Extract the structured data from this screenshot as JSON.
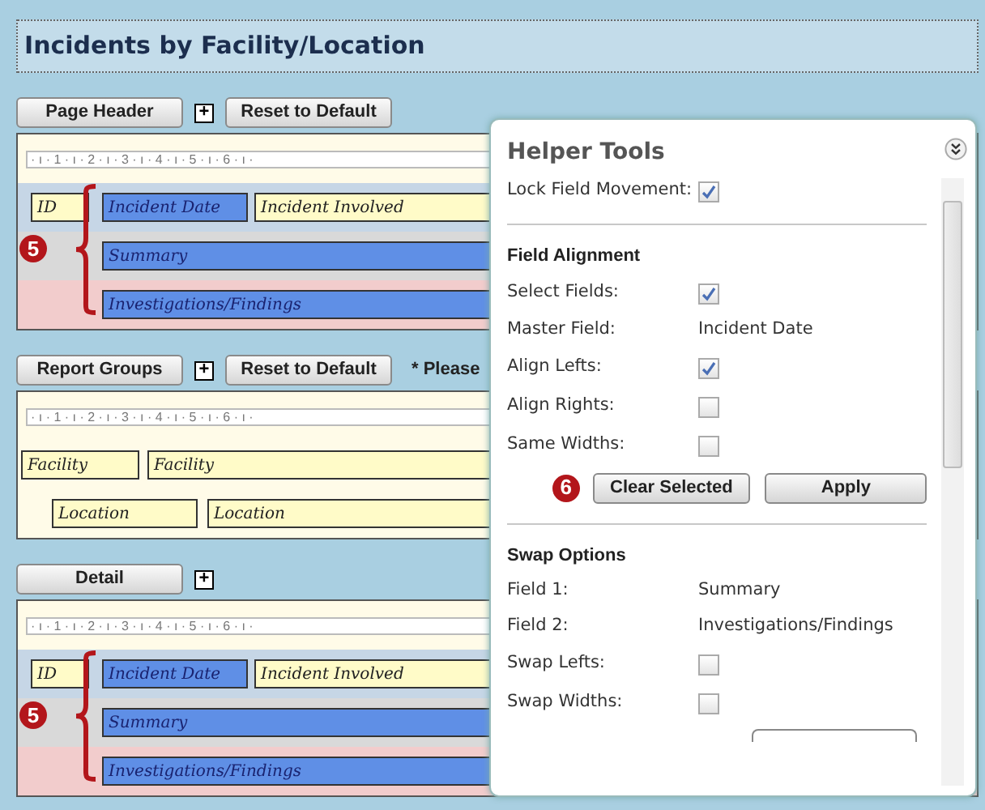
{
  "title": "Incidents by Facility/Location",
  "sections": [
    {
      "button": "Page Header",
      "expand": "+",
      "reset": "Reset to Default",
      "ruler": "· ı · 1 · ı · 2 · ı · 3 · ı · 4 · ı · 5 · ı · 6 · ı ·",
      "callout": "5",
      "rows": [
        {
          "fields": [
            {
              "text": "ID",
              "selected": false
            },
            {
              "text": "Incident Date",
              "selected": true
            },
            {
              "text": "Incident Involved",
              "selected": false
            }
          ]
        },
        {
          "fields": [
            {
              "text": "Summary",
              "selected": true
            }
          ]
        },
        {
          "fields": [
            {
              "text": "Investigations/Findings",
              "selected": true
            }
          ]
        }
      ]
    },
    {
      "button": "Report Groups",
      "expand": "+",
      "reset": "Reset to Default",
      "note": "* Please",
      "ruler": "· ı · 1 · ı · 2 · ı · 3 · ı · 4 · ı · 5 · ı · 6 · ı ·",
      "rows": [
        {
          "fields": [
            {
              "text": "Facility",
              "selected": false
            },
            {
              "text": "Facility",
              "selected": false
            }
          ]
        },
        {
          "fields": [
            {
              "text": "Location",
              "selected": false
            },
            {
              "text": "Location",
              "selected": false
            }
          ]
        }
      ]
    },
    {
      "button": "Detail",
      "expand": "+",
      "ruler": "· ı · 1 · ı · 2 · ı · 3 · ı · 4 · ı · 5 · ı · 6 · ı ·",
      "callout": "5",
      "rows": [
        {
          "fields": [
            {
              "text": "ID",
              "selected": false
            },
            {
              "text": "Incident Date",
              "selected": true
            },
            {
              "text": "Incident Involved",
              "selected": false
            }
          ]
        },
        {
          "fields": [
            {
              "text": "Summary",
              "selected": true
            }
          ]
        },
        {
          "fields": [
            {
              "text": "Investigations/Findings",
              "selected": true
            }
          ]
        }
      ]
    }
  ],
  "helper": {
    "title": "Helper Tools",
    "items": [
      {
        "kind": "checkbox",
        "label": "Lock Field Movement:",
        "checked": true
      },
      {
        "kind": "divider"
      },
      {
        "kind": "heading",
        "label": "Field Alignment"
      },
      {
        "kind": "checkbox",
        "label": "Select Fields:",
        "checked": true
      },
      {
        "kind": "value",
        "label": "Master Field:",
        "value": "Incident Date"
      },
      {
        "kind": "checkbox",
        "label": "Align Lefts:",
        "checked": true
      },
      {
        "kind": "checkbox",
        "label": "Align Rights:",
        "checked": false
      },
      {
        "kind": "checkbox",
        "label": "Same Widths:",
        "checked": false
      },
      {
        "kind": "buttons",
        "callout": "6",
        "buttons": [
          "Clear Selected",
          "Apply"
        ]
      },
      {
        "kind": "divider"
      },
      {
        "kind": "heading",
        "label": "Swap Options"
      },
      {
        "kind": "value",
        "label": "Field 1:",
        "value": "Summary"
      },
      {
        "kind": "value",
        "label": "Field 2:",
        "value": "Investigations/Findings"
      },
      {
        "kind": "checkbox",
        "label": "Swap Lefts:",
        "checked": false
      },
      {
        "kind": "checkbox",
        "label": "Swap Widths:",
        "checked": false
      },
      {
        "kind": "partial-button"
      }
    ]
  }
}
